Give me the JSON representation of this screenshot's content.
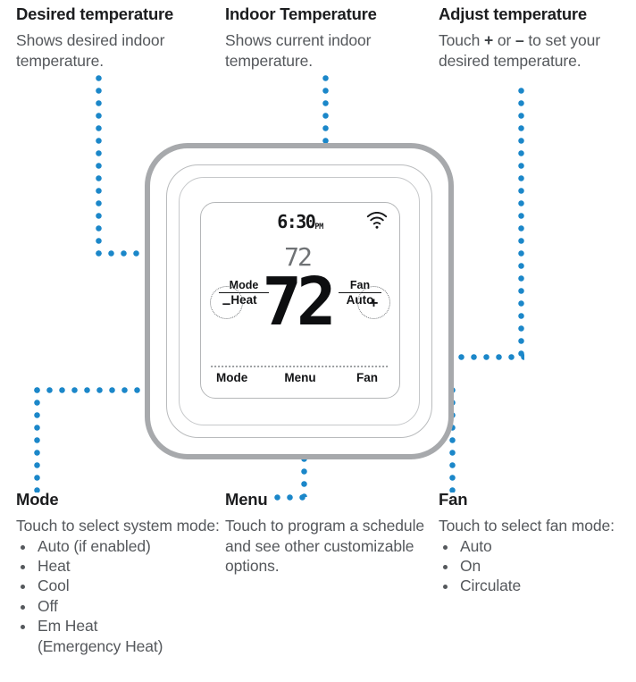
{
  "callouts": {
    "desired": {
      "title": "Desired temperature",
      "body": "Shows desired indoor temperature."
    },
    "indoor": {
      "title": "Indoor Temperature",
      "body": "Shows current indoor temperature."
    },
    "adjust": {
      "title": "Adjust temperature",
      "body_pre": "Touch ",
      "body_plus": "+",
      "body_mid": " or ",
      "body_minus": "–",
      "body_post": " to set your desired temperature."
    },
    "mode": {
      "title": "Mode",
      "body": "Touch to select system mode:",
      "items": [
        "Auto (if enabled)",
        "Heat",
        "Cool",
        "Off",
        "Em Heat"
      ],
      "items_continuation": "(Emergency Heat)"
    },
    "menu": {
      "title": "Menu",
      "body": "Touch to program a schedule and see other customizable options."
    },
    "fan": {
      "title": "Fan",
      "body": "Touch to select fan mode:",
      "items": [
        "Auto",
        "On",
        "Circulate"
      ]
    }
  },
  "thermostat": {
    "display": {
      "time": "6:30",
      "am_pm": "PM",
      "wifi_icon": "wifi-icon",
      "setpoint_temperature": "72",
      "current_temperature": "72",
      "mode_label": "Mode",
      "mode_value": "Heat",
      "fan_label": "Fan",
      "fan_value": "Auto",
      "decrease_button": "–",
      "increase_button": "+"
    },
    "softkeys": {
      "mode": "Mode",
      "menu": "Menu",
      "fan": "Fan"
    }
  },
  "colors": {
    "connector_blue": "#1b87c9",
    "bezel_gray": "#a7a9ac",
    "heading_black": "#1c1d1f",
    "body_gray": "#55585c"
  }
}
